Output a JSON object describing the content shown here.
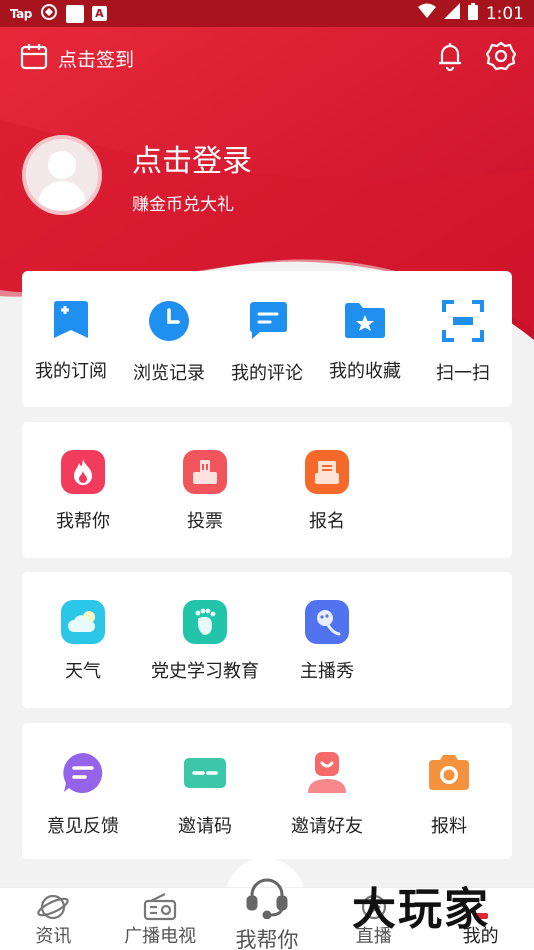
{
  "status_bar": {
    "carrier_icon": "Tap",
    "time": "1:01",
    "icons": [
      "hotspot-icon",
      "square-icon",
      "a-icon",
      "wifi-icon",
      "signal-icon",
      "battery-icon"
    ]
  },
  "header": {
    "checkin_label": "点击签到",
    "icons": [
      "calendar-icon",
      "bell-icon",
      "settings-icon"
    ]
  },
  "profile": {
    "login_label": "点击登录",
    "subtitle": "赚金币兑大礼"
  },
  "quick_actions": [
    {
      "label": "我的订阅",
      "icon": "subscribe-icon",
      "color": "#1f8ff0"
    },
    {
      "label": "浏览记录",
      "icon": "clock-icon",
      "color": "#1f8ff0"
    },
    {
      "label": "我的评论",
      "icon": "comment-icon",
      "color": "#1f8ff0"
    },
    {
      "label": "我的收藏",
      "icon": "folder-star-icon",
      "color": "#1f8ff0"
    },
    {
      "label": "扫一扫",
      "icon": "scan-icon",
      "color": "#1f8ff0"
    }
  ],
  "section_help": [
    {
      "label": "我帮你",
      "icon": "fire-icon",
      "color": "#f23c5e"
    },
    {
      "label": "投票",
      "icon": "vote-icon",
      "color": "#f0555b"
    },
    {
      "label": "报名",
      "icon": "signup-icon",
      "color": "#f56a2a"
    }
  ],
  "section_services": [
    {
      "label": "天气",
      "icon": "weather-icon",
      "color": "#2cc6e8"
    },
    {
      "label": "党史学习教育",
      "icon": "footprint-icon",
      "color": "#22c4aa"
    },
    {
      "label": "主播秀",
      "icon": "microphone-icon",
      "color": "#5273f0"
    }
  ],
  "section_more": [
    {
      "label": "意见反馈",
      "icon": "feedback-icon",
      "color": "#9563ea"
    },
    {
      "label": "邀请码",
      "icon": "invite-code-icon",
      "color": "#3bc7a8"
    },
    {
      "label": "邀请好友",
      "icon": "invite-friend-icon",
      "color": "#f56a6a"
    },
    {
      "label": "报料",
      "icon": "camera-icon",
      "color": "#f5923e"
    }
  ],
  "tabbar": [
    {
      "label": "资讯",
      "icon": "planet-icon"
    },
    {
      "label": "广播电视",
      "icon": "radio-icon"
    },
    {
      "label": "我帮你",
      "icon": "headset-icon"
    },
    {
      "label": "直播",
      "icon": "live-icon"
    },
    {
      "label": "我的",
      "icon": "user-icon"
    }
  ],
  "colors": {
    "brand_red": "#d31a2b",
    "accent_blue": "#1f8ff0"
  },
  "watermark": "大玩家"
}
